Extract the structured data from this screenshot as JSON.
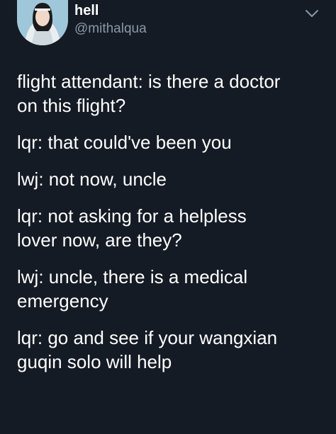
{
  "tweet": {
    "author": {
      "name": "hell",
      "handle": "@mithalqua",
      "avatar_icon": "profile-photo"
    },
    "menu_icon": "chevron-down-icon",
    "paragraphs": [
      {
        "lines": [
          "flight attendant: is there a doctor",
          "on this flight?"
        ]
      },
      {
        "lines": [
          "lqr: that could've been you"
        ]
      },
      {
        "lines": [
          "lwj: not now, uncle"
        ]
      },
      {
        "lines": [
          "lqr: not asking for a helpless",
          "lover now, are they?"
        ]
      },
      {
        "lines": [
          "lwj: uncle, there is a medical",
          "emergency"
        ]
      },
      {
        "lines": [
          "lqr: go and see if your wangxian",
          "guqin solo will help"
        ]
      }
    ]
  },
  "colors": {
    "background": "#151b25",
    "text": "#ffffff",
    "secondary_text": "#8899a6"
  }
}
